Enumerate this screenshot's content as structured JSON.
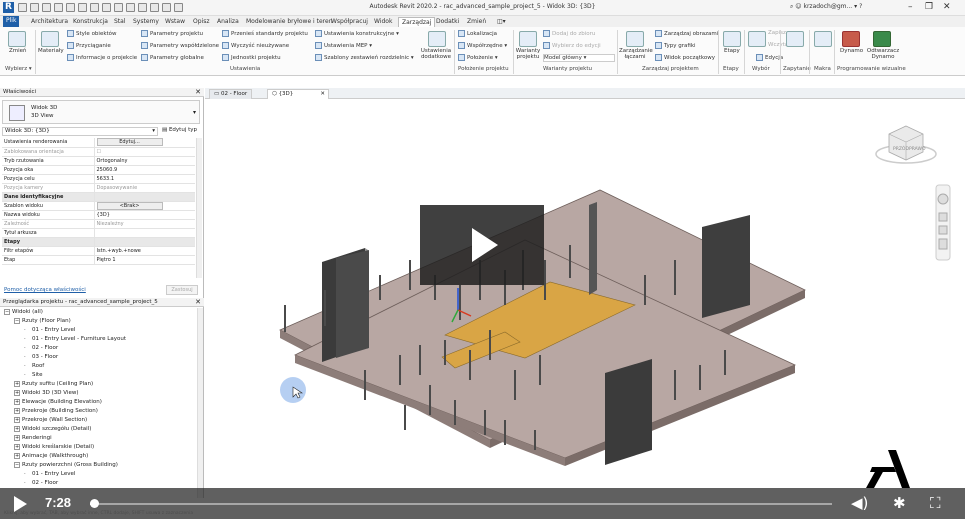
{
  "window": {
    "title": "Autodesk Revit 2020.2 - rac_advanced_sample_project_5 - Widok 3D: {3D}",
    "user": "krzadoch@gm...",
    "help": "?",
    "controls": [
      "–",
      "❐",
      "✕"
    ]
  },
  "ribbon_tabs": [
    "Plik",
    "Architektura",
    "Konstrukcja",
    "Stal",
    "Systemy",
    "Wstaw",
    "Opisz",
    "Analiza",
    "Modelowanie bryłowe i teren",
    "Współpracuj",
    "Widok",
    "Zarządzaj",
    "Dodatki",
    "Zmień"
  ],
  "active_tab": "Zarządzaj",
  "ribbon": {
    "wybierz": {
      "big_label": "Zmień",
      "panel": "Wybierz ▾"
    },
    "materialy": "Materiały",
    "settings": [
      "Style obiektów",
      "Przyciąganie",
      "Informacje o projekcie",
      "Parametry projektu",
      "Parametry współdzielone",
      "Parametry globalne",
      "Przenieś standardy projektu",
      "Wyczyść nieużywane",
      "Jednostki projektu",
      "Ustawienia konstrukcyjne ▾",
      "Ustawienia MEP ▾",
      "Szablony zestawień rozdzielnic ▾",
      "Ustawienia dodatkowe"
    ],
    "settings_panel": "Ustawienia",
    "location": [
      "Lokalizacja",
      "Współrzędne ▾",
      "Położenie ▾"
    ],
    "location_panel": "Położenie projektu",
    "options": [
      "Dodaj do zbioru",
      "Wybierz do edycji",
      "Model główny"
    ],
    "options_big": "Warianty projektu",
    "options_panel": "Warianty projektu",
    "manage": [
      "Zarządzaj obrazami",
      "Typy grafiki",
      "Widok początkowy"
    ],
    "manage_big": "Zarządzanie łączami",
    "manage_panel": "Zarządzaj projektem",
    "phases": "Etapy",
    "phases_panel": "Etapy",
    "selection": [
      "Zapisz",
      "Wczytaj",
      "Edycja"
    ],
    "selection_panel": "Wybór",
    "inquiry": "Zapytanie",
    "macros": "Makra",
    "dynamo": [
      "Dynamo",
      "Odtwarzacz Dynamo"
    ],
    "dynamo_panel": "Programowanie wizualne"
  },
  "properties": {
    "header": "Właściwości",
    "type_name": "Widok 3D",
    "type_sub": "3D View",
    "selector": "Widok 3D: {3D}",
    "edit_type": "Edytuj typ",
    "rows": [
      {
        "label": "Ustawienia renderowania",
        "value": "Edytuj...",
        "button": true
      },
      {
        "label": "Zablokowana orientacja",
        "value": "☐",
        "grey": true
      },
      {
        "label": "Tryb rzutowania",
        "value": "Ortogonalny"
      },
      {
        "label": "Pozycja oka",
        "value": "25060.9"
      },
      {
        "label": "Pozycja celu",
        "value": "5633.1"
      },
      {
        "label": "Pozycja kamery",
        "value": "Dopasowywanie",
        "grey": true
      },
      {
        "label": "Dane identyfikacyjne",
        "value": "",
        "group": true
      },
      {
        "label": "Szablon widoku",
        "value": "<Brak>",
        "button": true
      },
      {
        "label": "Nazwa widoku",
        "value": "{3D}"
      },
      {
        "label": "Zależność",
        "value": "Niezależny",
        "grey": true
      },
      {
        "label": "Tytuł arkusza",
        "value": ""
      },
      {
        "label": "Etapy",
        "value": "",
        "group": true
      },
      {
        "label": "Filtr etapów",
        "value": "Istn.+wyb.+nowe"
      },
      {
        "label": "Etap",
        "value": "Piętro 1"
      }
    ],
    "help_link": "Pomoc dotycząca właściwości",
    "apply": "Zastosuj"
  },
  "browser": {
    "header": "Przeglądarka projektu - rac_advanced_sample_project_5",
    "nodes": [
      {
        "level": 0,
        "toggle": "−",
        "label": "Widoki (all)"
      },
      {
        "level": 1,
        "toggle": "−",
        "label": "Rzuty (Floor Plan)"
      },
      {
        "level": 2,
        "toggle": "",
        "label": "01 - Entry Level"
      },
      {
        "level": 2,
        "toggle": "",
        "label": "01 - Entry Level - Furniture Layout"
      },
      {
        "level": 2,
        "toggle": "",
        "label": "02 - Floor"
      },
      {
        "level": 2,
        "toggle": "",
        "label": "03 - Floor"
      },
      {
        "level": 2,
        "toggle": "",
        "label": "Roof"
      },
      {
        "level": 2,
        "toggle": "",
        "label": "Site"
      },
      {
        "level": 1,
        "toggle": "+",
        "label": "Rzuty sufitu (Ceiling Plan)"
      },
      {
        "level": 1,
        "toggle": "+",
        "label": "Widoki 3D (3D View)"
      },
      {
        "level": 1,
        "toggle": "+",
        "label": "Elewacje (Building Elevation)"
      },
      {
        "level": 1,
        "toggle": "+",
        "label": "Przekroje (Building Section)"
      },
      {
        "level": 1,
        "toggle": "+",
        "label": "Przekroje (Wall Section)"
      },
      {
        "level": 1,
        "toggle": "+",
        "label": "Widoki szczegółu (Detail)"
      },
      {
        "level": 1,
        "toggle": "+",
        "label": "Renderingi"
      },
      {
        "level": 1,
        "toggle": "+",
        "label": "Widoki kreślarskie (Detail)"
      },
      {
        "level": 1,
        "toggle": "+",
        "label": "Animacje (Walkthrough)"
      },
      {
        "level": 1,
        "toggle": "−",
        "label": "Rzuty powierzchni (Gross Building)"
      },
      {
        "level": 2,
        "toggle": "",
        "label": "01 - Entry Level"
      },
      {
        "level": 2,
        "toggle": "",
        "label": "02 - Floor"
      }
    ]
  },
  "view_tabs": [
    {
      "label": "02 - Floor",
      "active": false
    },
    {
      "label": "{3D}",
      "active": true
    }
  ],
  "viewcube": {
    "left": "PRZÓD",
    "right": "PRAWO"
  },
  "video": {
    "time": "7:28",
    "progress": 0.005
  },
  "status": "Kliknij, aby wybrać, TAB, aby wybrać inne, CTRL dodaje, SHIFT usuwa z zaznaczenia"
}
